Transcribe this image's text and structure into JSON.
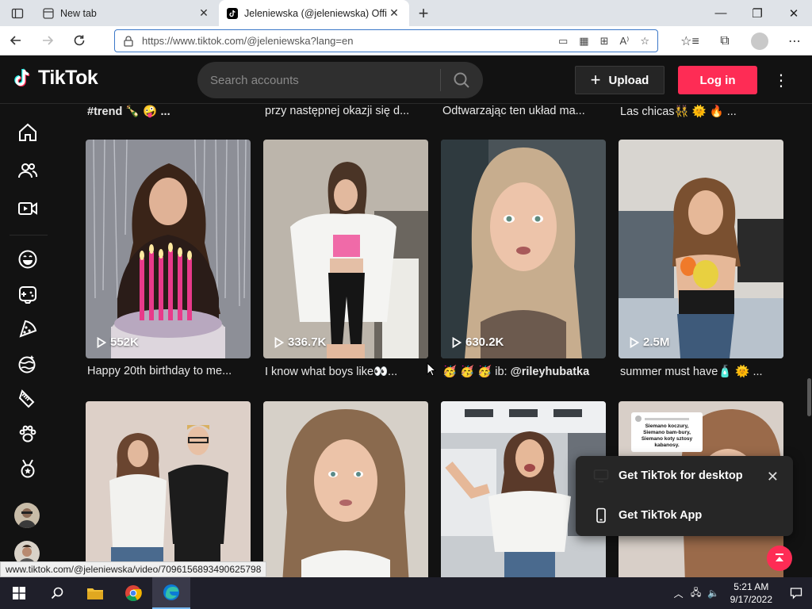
{
  "browser": {
    "tabs": [
      {
        "label": "New tab",
        "active": false
      },
      {
        "label": "Jeleniewska (@jeleniewska) Offic",
        "active": true
      }
    ],
    "url": "https://www.tiktok.com/@jeleniewska?lang=en",
    "status_url": "www.tiktok.com/@jeleniewska/video/7096156893490625798"
  },
  "header": {
    "logo_text": "TikTok",
    "search_placeholder": "Search accounts",
    "upload_label": "Upload",
    "login_label": "Log in"
  },
  "top_captions": [
    {
      "text": "#trend 🍾 🤪 ..."
    },
    {
      "text": "przy następnej okazji się d..."
    },
    {
      "text": "Odtwarzając ten układ ma..."
    },
    {
      "text": "Las chicas👯 🌞 🔥 ..."
    }
  ],
  "videos_row1": [
    {
      "views": "552K",
      "caption": "Happy 20th birthday to me..."
    },
    {
      "views": "336.7K",
      "caption": "I know what boys like👀..."
    },
    {
      "views": "630.2K",
      "caption_prefix": "🥳 🥳 🥳 ib: ",
      "caption_bold": "@rileyhubatka"
    },
    {
      "views": "2.5M",
      "caption": "summer must have🧴 🌞 ..."
    }
  ],
  "popup": {
    "desktop_label": "Get TikTok for desktop",
    "app_label": "Get TikTok App"
  },
  "thumb_comment": {
    "line1": "Siemano koczury,",
    "line2": "Siemano bam-bury,",
    "line3": "Siemano koty sztosy",
    "line4": "kabanosy."
  },
  "taskbar": {
    "time": "5:21 AM",
    "date": "9/17/2022"
  },
  "colors": {
    "brand": "#fe2c55",
    "background": "#121212"
  }
}
